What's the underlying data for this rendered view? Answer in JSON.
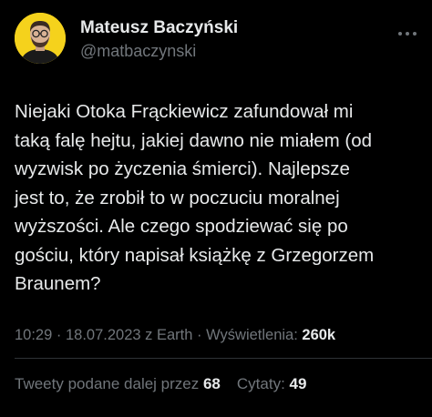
{
  "colors": {
    "background": "#000000",
    "text": "#e7e9ea",
    "muted": "#71767b",
    "divider": "#2f3336",
    "avatar_bg": "#f5d21c"
  },
  "author": {
    "name": "Mateusz Baczyński",
    "handle": "@matbaczynski",
    "avatar_icon": "profile-photo"
  },
  "tweet": {
    "text": "Niejaki Otoka Frąckiewicz zafundował mi\ntaką falę hejtu, jakiej dawno nie miałem (od\nwyzwisk po życzenia śmierci). Najlepsze\njest to, że zrobił to w poczuciu moralnej\nwyższości. Ale czego spodziewać się po\ngościu, który napisał książkę z Grzegorzem\nBraunem?"
  },
  "meta": {
    "time": "10:29",
    "separator1": " · ",
    "date": "18.07.2023",
    "source": " z Earth",
    "separator2": " · ",
    "views_label": "Wyświetlenia: ",
    "views_count": "260k"
  },
  "stats": {
    "retweets_label": "Tweety podane dalej przez ",
    "retweets_count": "68",
    "quotes_label": "Cytaty: ",
    "quotes_count": "49"
  },
  "icons": {
    "more": "more-horizontal-icon"
  }
}
